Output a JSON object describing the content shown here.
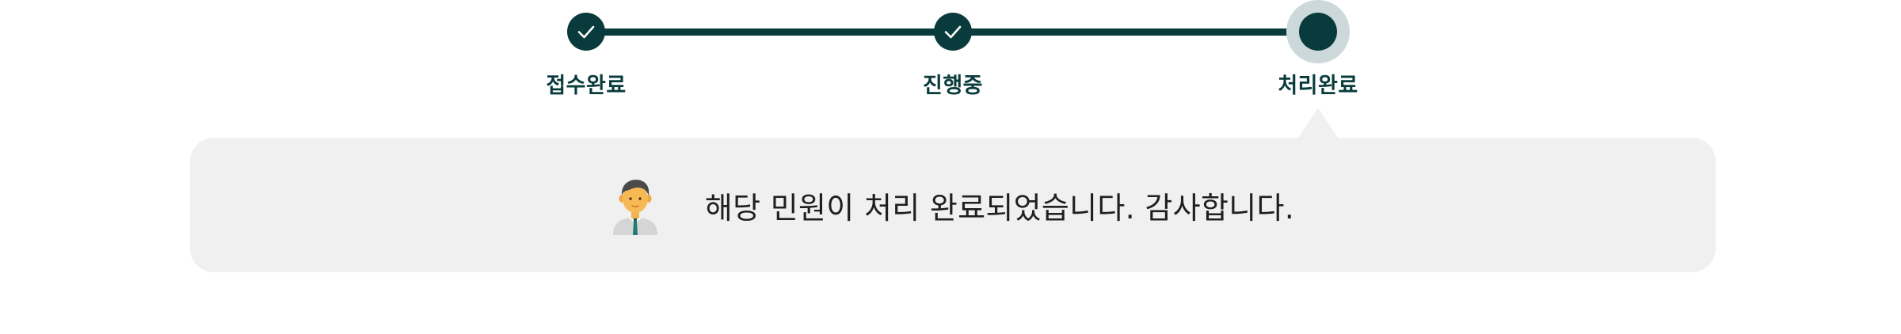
{
  "stepper": {
    "steps": [
      {
        "label": "접수완료",
        "state": "completed",
        "icon": "check-icon"
      },
      {
        "label": "진행중",
        "state": "completed",
        "icon": "check-icon"
      },
      {
        "label": "처리완료",
        "state": "current",
        "icon": "current-dot"
      }
    ],
    "colors": {
      "active": "#0a3b3c",
      "halo": "#ccd8d9"
    }
  },
  "status_message": {
    "text": "해당 민원이 처리 완료되었습니다. 감사합니다.",
    "avatar_icon": "official-avatar-icon",
    "background": "#f0f0f0"
  }
}
